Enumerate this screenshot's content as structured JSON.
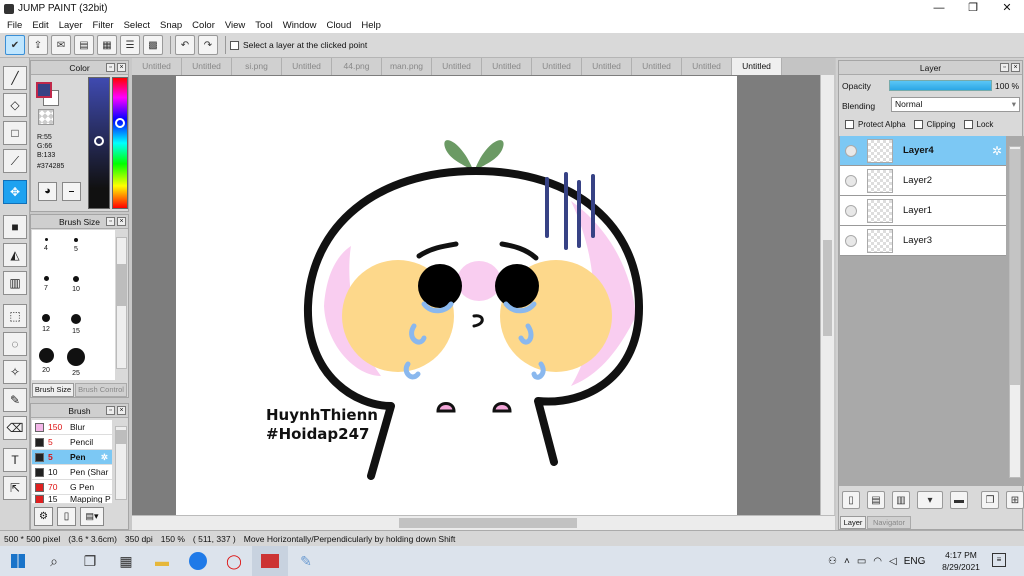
{
  "window": {
    "title": "JUMP PAINT (32bit)",
    "min": "—",
    "max": "❐",
    "close": "✕"
  },
  "menu": [
    "File",
    "Edit",
    "Layer",
    "Filter",
    "Select",
    "Snap",
    "Color",
    "View",
    "Tool",
    "Window",
    "Cloud",
    "Help"
  ],
  "toolbar": {
    "select_layer_label": "Select a layer at the clicked point"
  },
  "tabs": [
    "Untitled",
    "Untitled",
    "si.png",
    "Untitled",
    "44.png",
    "man.png",
    "Untitled",
    "Untitled",
    "Untitled",
    "Untitled",
    "Untitled",
    "Untitled",
    "Untitled"
  ],
  "color_panel": {
    "title": "Color",
    "r": "R:55",
    "g": "G:66",
    "b": "B:133",
    "hex": "#374285",
    "fg": "#374285",
    "bg": "#ffffff"
  },
  "brush_size_panel": {
    "title": "Brush Size",
    "sizes": [
      "4",
      "5",
      "7",
      "10",
      "12",
      "15",
      "20",
      "25"
    ],
    "tab_active": "Brush Size",
    "tab_other": "Brush Control"
  },
  "brush_panel": {
    "title": "Brush",
    "items": [
      {
        "size": "150",
        "name": "Blur",
        "color": "#f3b6e8"
      },
      {
        "size": "5",
        "name": "Pencil",
        "color": "#222222"
      },
      {
        "size": "5",
        "name": "Pen",
        "color": "#222222"
      },
      {
        "size": "10",
        "name": "Pen (Shar",
        "color": "#222222"
      },
      {
        "size": "70",
        "name": "G Pen",
        "color": "#e02020"
      },
      {
        "size": "15",
        "name": "Mapping P",
        "color": "#e02020"
      }
    ]
  },
  "canvas": {
    "watermark_line1": "HuynhThienn",
    "watermark_line2": "#Hoidap247"
  },
  "layer_panel": {
    "title": "Layer",
    "opacity_label": "Opacity",
    "opacity_value": "100 %",
    "blending_label": "Blending",
    "blending_value": "Normal",
    "protect_alpha": "Protect Alpha",
    "clipping": "Clipping",
    "lock": "Lock",
    "layers": [
      "Layer4",
      "Layer2",
      "Layer1",
      "Layer3"
    ],
    "tab_layer": "Layer",
    "tab_navigator": "Navigator"
  },
  "status": {
    "size": "500 * 500 pixel",
    "cm": "(3.6 * 3.6cm)",
    "dpi": "350 dpi",
    "zoom": "150 %",
    "coords": "( 511, 337 )",
    "hint": "Move Horizontally/Perpendicularly by holding down Shift"
  },
  "taskbar": {
    "lang": "ENG",
    "time": "4:17 PM",
    "date": "8/29/2021"
  }
}
